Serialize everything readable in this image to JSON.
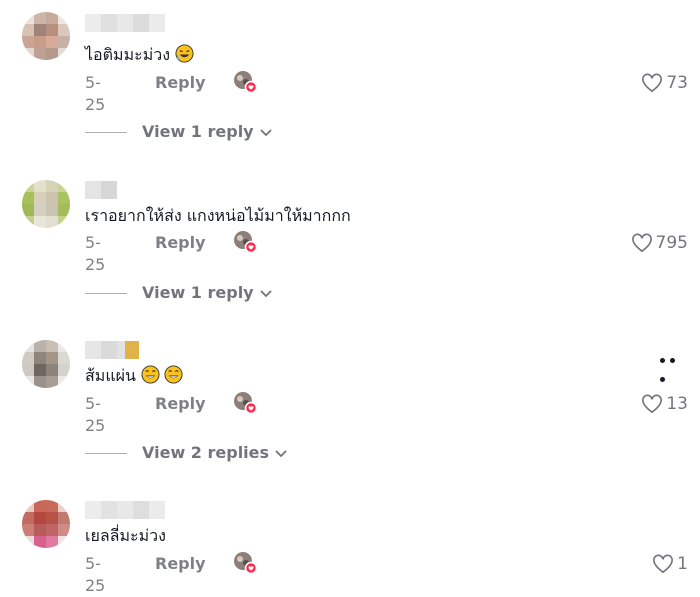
{
  "comments": [
    {
      "text": "ไอติมมะม่วง",
      "emoji": [
        "rolling-laughing-emoji"
      ],
      "date": "5-25",
      "reply_label": "Reply",
      "likes": "73",
      "view_replies": "View 1 reply"
    },
    {
      "text": "เราอยากให้ส่ง แกงหน่อไม้มาให้มากกก",
      "emoji": [],
      "date": "5-25",
      "reply_label": "Reply",
      "likes": "795",
      "view_replies": "View 1 reply"
    },
    {
      "text": "ส้มแผ่น",
      "emoji": [
        "joy-emoji",
        "joy-emoji"
      ],
      "date": "5-25",
      "reply_label": "Reply",
      "likes": "13",
      "view_replies": "View 2 replies"
    },
    {
      "text": "เยลลี่มะม่วง",
      "emoji": [],
      "date": "5-25",
      "reply_label": "Reply",
      "likes": "1",
      "view_replies": ""
    }
  ],
  "icons": {
    "like": "heart-outline-icon",
    "expand": "chevron-down-icon",
    "more": "more-dots-icon",
    "creator_liked": "creator-liked-avatar-icon"
  },
  "colors": {
    "text_primary": "#161823",
    "text_secondary": "#8a8b91",
    "heart_badge": "#fe2c55"
  }
}
